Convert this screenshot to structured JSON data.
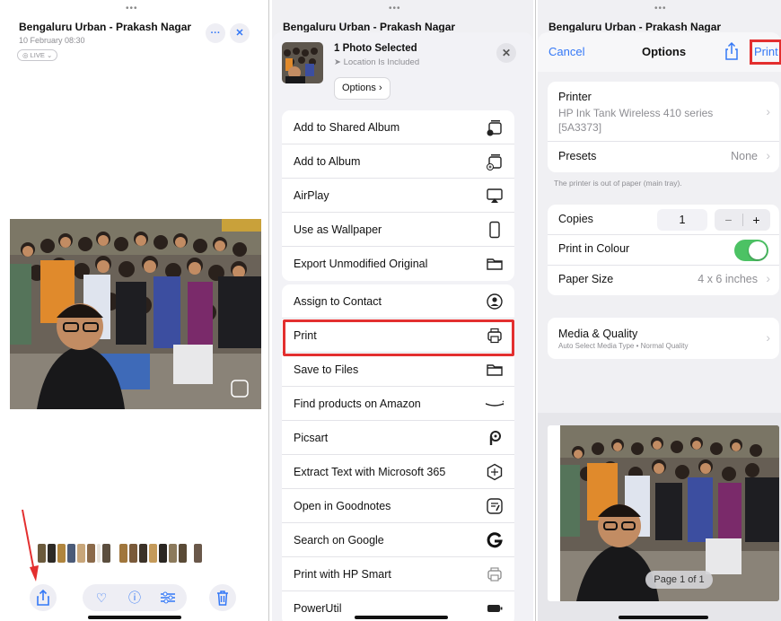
{
  "panel1": {
    "title": "Bengaluru Urban - Prakash Nagar",
    "date": "10 February 08:30",
    "live_label": "LIVE"
  },
  "panel2": {
    "header_title": "Bengaluru Urban - Prakash Nagar",
    "sheet_title": "1 Photo Selected",
    "sheet_subtitle": "Location Is Included",
    "options_label": "Options",
    "group1": [
      "Add to Shared Album",
      "Add to Album",
      "AirPlay",
      "Use as Wallpaper",
      "Export Unmodified Original"
    ],
    "group2": [
      "Assign to Contact",
      "Print",
      "Save to Files",
      "Find products on Amazon",
      "Picsart",
      "Extract Text with Microsoft 365",
      "Open in Goodnotes",
      "Search on Google",
      "Print with HP Smart",
      "PowerUtil"
    ]
  },
  "panel3": {
    "header_title": "Bengaluru Urban - Prakash Nagar",
    "cancel": "Cancel",
    "title": "Options",
    "print": "Print",
    "printer_label": "Printer",
    "printer_name": "HP Ink Tank Wireless 410 series",
    "printer_id": "[5A3373]",
    "presets_label": "Presets",
    "presets_value": "None",
    "note": "The printer is out of paper (main tray).",
    "copies_label": "Copies",
    "copies_value": "1",
    "colour_label": "Print in Colour",
    "colour_on": true,
    "paper_label": "Paper Size",
    "paper_value": "4 x 6 inches",
    "media_label": "Media & Quality",
    "media_sub": "Auto Select Media Type • Normal Quality",
    "page_badge": "Page 1 of 1"
  },
  "icons": {
    "share": "share-icon",
    "favorite": "heart-icon",
    "info": "info-icon",
    "adjust": "sliders-icon",
    "delete": "trash-icon",
    "toggle_on": "#4cc264",
    "accent": "#3478f6",
    "highlight": "#e32f2f"
  }
}
